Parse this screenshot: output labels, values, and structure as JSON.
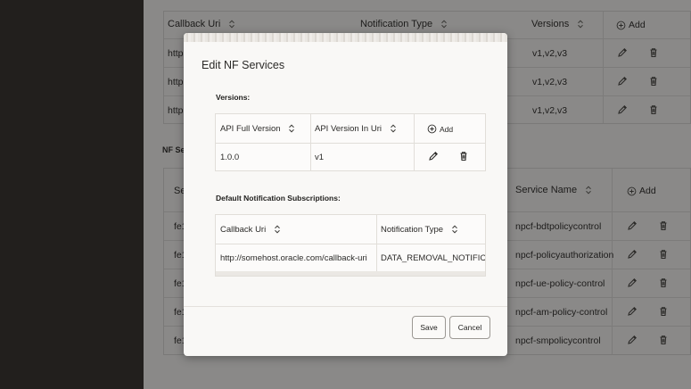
{
  "background": {
    "top_table": {
      "headers": [
        "Callback Uri",
        "Notification Type",
        "Versions"
      ],
      "add_label": "Add",
      "rows": [
        {
          "uri": "http",
          "versions": "v1,v2,v3"
        },
        {
          "uri": "http",
          "versions": "v1,v2,v3"
        },
        {
          "uri": "http",
          "versions": "v1,v2,v3"
        }
      ]
    },
    "section_label": "NF Se",
    "services_table": {
      "col_fragment": "Se",
      "service_name_header": "Service Name",
      "add_label": "Add",
      "rows": [
        {
          "id": "fe1",
          "service": "npcf-bdtpolicycontrol"
        },
        {
          "id": "fe1",
          "service": "npcf-policyauthorization"
        },
        {
          "id": "fe1",
          "service": "npcf-ue-policy-control"
        },
        {
          "id": "fe1",
          "service": "npcf-am-policy-control"
        },
        {
          "id": "fe1",
          "service": "npcf-smpolicycontrol"
        }
      ]
    }
  },
  "modal": {
    "title": "Edit NF Services",
    "versions": {
      "label": "Versions:",
      "headers": [
        "API Full Version",
        "API Version In Uri"
      ],
      "add_label": "Add",
      "rows": [
        {
          "full": "1.0.0",
          "in_uri": "v1"
        }
      ]
    },
    "subscriptions": {
      "label": "Default Notification Subscriptions:",
      "headers": [
        "Callback Uri",
        "Notification Type"
      ],
      "rows": [
        {
          "uri": "http://somehost.oracle.com/callback-uri",
          "type": "DATA_REMOVAL_NOTIFICATION"
        }
      ]
    },
    "buttons": {
      "save": "Save",
      "cancel": "Cancel"
    }
  },
  "colors": {
    "sidebar": "#221f1d",
    "overlay": "#8a8988",
    "modal_bg": "#f9f8f6"
  },
  "icons": [
    "sort-icon",
    "add-circle-icon",
    "pencil-icon",
    "trash-icon"
  ]
}
